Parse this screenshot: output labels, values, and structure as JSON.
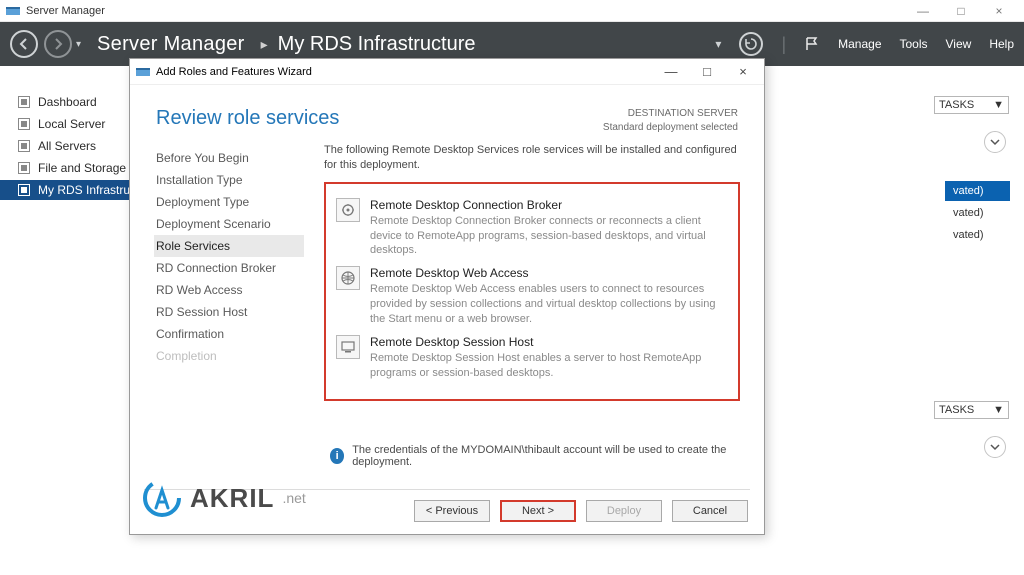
{
  "window": {
    "title": "Server Manager",
    "minimize": "—",
    "restore": "□",
    "close": "×"
  },
  "cmdbar": {
    "crumb1": "Server Manager",
    "crumb2": "My RDS Infrastructure",
    "menu": {
      "manage": "Manage",
      "tools": "Tools",
      "view": "View",
      "help": "Help"
    }
  },
  "leftnav": {
    "items": [
      {
        "label": "Dashboard"
      },
      {
        "label": "Local Server"
      },
      {
        "label": "All Servers"
      },
      {
        "label": "File and Storage S"
      },
      {
        "label": "My RDS Infrastruct"
      }
    ],
    "selectedIndex": 4
  },
  "background": {
    "tasks_label": "TASKS",
    "row_selected": "vated)",
    "row1": "vated)",
    "row2": "vated)"
  },
  "wizard": {
    "title": "Add Roles and Features Wizard",
    "heading": "Review role services",
    "dest_caption": "DESTINATION SERVER",
    "dest_value": "Standard deployment selected",
    "steps": [
      "Before You Begin",
      "Installation Type",
      "Deployment Type",
      "Deployment Scenario",
      "Role Services",
      "RD Connection Broker",
      "RD Web Access",
      "RD Session Host",
      "Confirmation",
      "Completion"
    ],
    "currentStepIndex": 4,
    "disabledStepIndex": 9,
    "intro": "The following Remote Desktop Services role services will be installed and configured for this deployment.",
    "roles": [
      {
        "title": "Remote Desktop Connection Broker",
        "desc": "Remote Desktop Connection Broker connects or reconnects a client device to RemoteApp programs, session-based desktops, and virtual desktops."
      },
      {
        "title": "Remote Desktop Web Access",
        "desc": "Remote Desktop Web Access enables users to connect to resources provided by session collections and virtual desktop collections by using the Start menu or a web browser."
      },
      {
        "title": "Remote Desktop Session Host",
        "desc": "Remote Desktop Session Host enables a server to host RemoteApp programs or session-based desktops."
      }
    ],
    "info": "The credentials of the MYDOMAIN\\thibault account will be used to create the deployment.",
    "buttons": {
      "previous": "< Previous",
      "next": "Next >",
      "deploy": "Deploy",
      "cancel": "Cancel"
    }
  },
  "watermark": {
    "brand": "AKRIL",
    "suffix": ".net"
  }
}
